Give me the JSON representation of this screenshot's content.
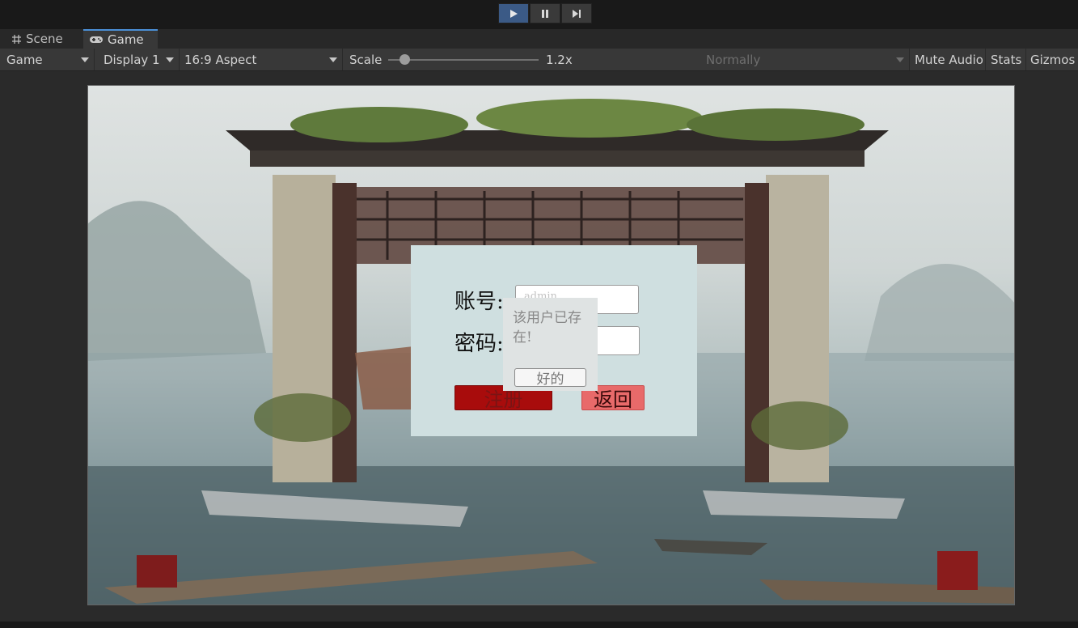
{
  "playbar": {
    "play_icon": "play-icon",
    "pause_icon": "pause-icon",
    "step_icon": "step-icon"
  },
  "tabs": [
    {
      "label": "Scene",
      "icon": "grid-icon"
    },
    {
      "label": "Game",
      "icon": "gamepad-icon"
    }
  ],
  "toolbar": {
    "view_select": "Game",
    "display_select": "Display 1",
    "aspect_select": "16:9 Aspect",
    "scale_label": "Scale",
    "scale_value": 0.1,
    "scale_text": "1.2x",
    "play_mode_select": "Normally",
    "mute_audio": "Mute Audio",
    "stats": "Stats",
    "gizmos": "Gizmos"
  },
  "dialog": {
    "account_label": "账号:",
    "account_placeholder": "admin",
    "password_label": "密码:",
    "password_value": "",
    "register_button": "注册",
    "back_button": "返回"
  },
  "popup": {
    "message": "该用户已存在!",
    "ok_button": "好的"
  },
  "colors": {
    "dialog_bg": "#cfdfe0",
    "register_bg": "#a80c0c",
    "back_bg": "#e86a6a",
    "active_play": "#3b5a86"
  }
}
